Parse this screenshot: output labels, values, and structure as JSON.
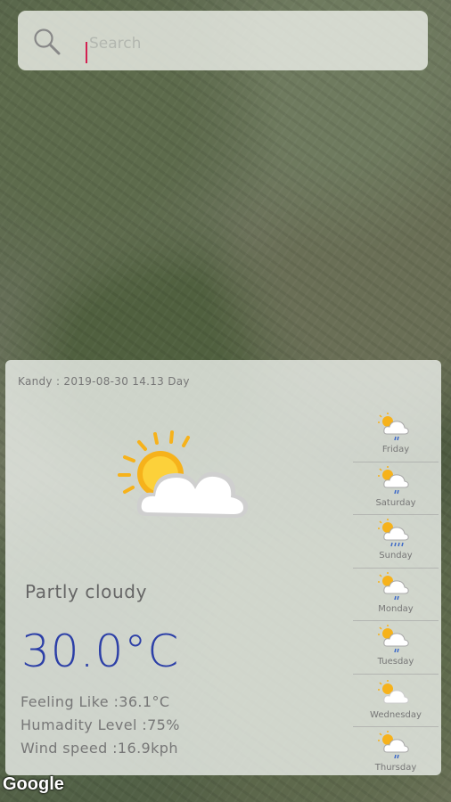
{
  "search": {
    "placeholder": "Search"
  },
  "current": {
    "location_time": "Kandy : 2019-08-30 14.13 Day",
    "condition": "Partly cloudy",
    "temperature": "30.0°C",
    "feeling": "Feeling Like :36.1°C",
    "humidity": "Humadity Level :75%",
    "wind": "Wind speed :16.9kph",
    "icon": "partly-cloudy-icon"
  },
  "forecast": [
    {
      "day": "Friday",
      "icon": "rain-sun-icon"
    },
    {
      "day": "Saturday",
      "icon": "rain-sun-icon"
    },
    {
      "day": "Sunday",
      "icon": "heavy-rain-sun-icon"
    },
    {
      "day": "Monday",
      "icon": "rain-sun-icon"
    },
    {
      "day": "Tuesday",
      "icon": "rain-sun-icon"
    },
    {
      "day": "Wednesday",
      "icon": "partly-cloudy-icon"
    },
    {
      "day": "Thursday",
      "icon": "rain-sun-icon"
    }
  ],
  "map": {
    "attribution": "Google"
  },
  "colors": {
    "temperature": "#2c3fa7",
    "caret": "#d32050"
  }
}
